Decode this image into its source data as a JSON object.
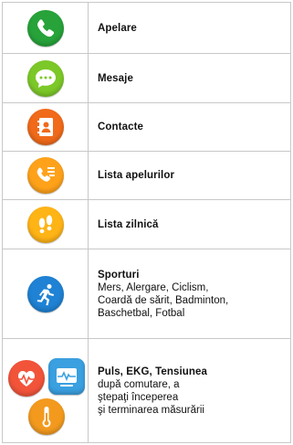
{
  "colors": {
    "phone": "#27a33a",
    "messages": "#7cc828",
    "contacts": "#f06a1a",
    "call_list": "#ffa21a",
    "daily_list": "#ffb416",
    "sports": "#1f82d4",
    "heart": "#f2543a",
    "ekg": "#3aa0e0",
    "pressure": "#f39a1e",
    "border": "#c8c8c8"
  },
  "rows": [
    {
      "icon": "phone-icon",
      "title": "Apelare",
      "desc": []
    },
    {
      "icon": "messages-icon",
      "title": "Mesaje",
      "desc": []
    },
    {
      "icon": "contacts-icon",
      "title": "Contacte",
      "desc": []
    },
    {
      "icon": "call-list-icon",
      "title": "Lista apelurilor",
      "desc": []
    },
    {
      "icon": "footprints-icon",
      "title": "Lista zilnică",
      "desc": []
    },
    {
      "icon": "running-icon",
      "title": "Sporturi",
      "desc": [
        "Mers, Alergare, Ciclism,",
        "Coardă de sărit, Badminton,",
        "Baschetbal, Fotbal"
      ]
    },
    {
      "icons": [
        "heart-rate-icon",
        "ekg-icon",
        "thermometer-icon"
      ],
      "title": "Puls, EKG, Tensiunea",
      "desc": [
        "după comutare, a",
        "ştepaţi începerea",
        "şi terminarea măsurării"
      ]
    }
  ]
}
